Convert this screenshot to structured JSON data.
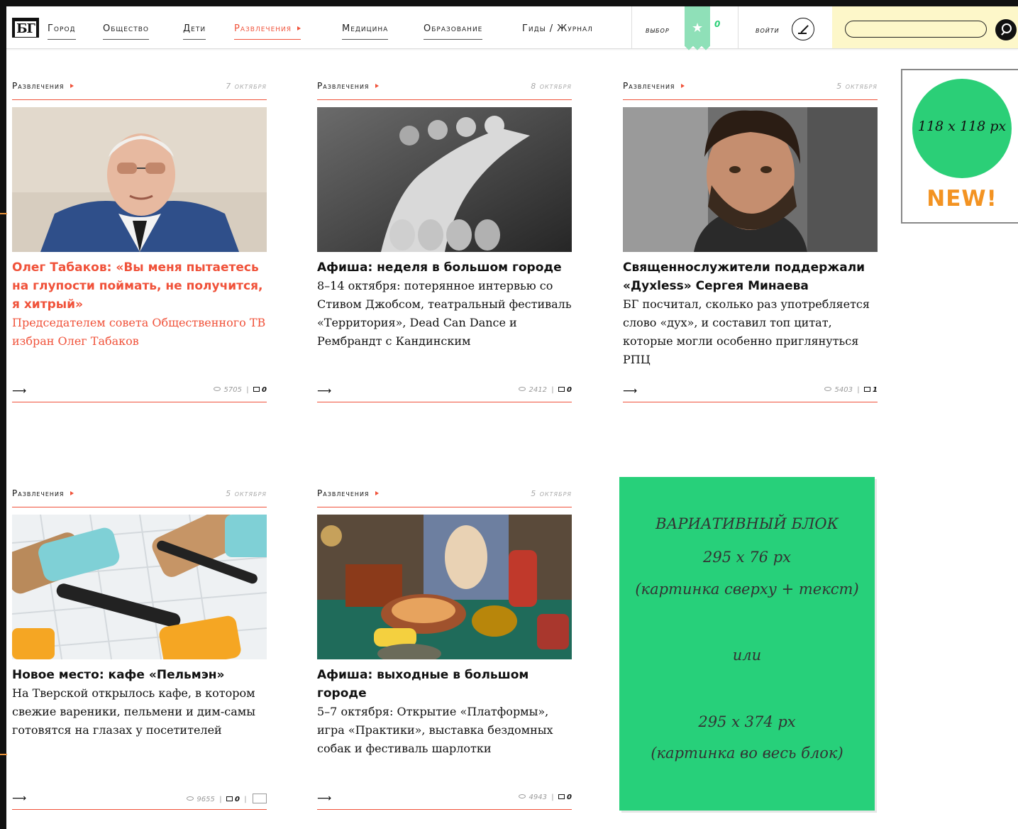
{
  "header": {
    "logo": "БГ",
    "nav": [
      {
        "label": "Город",
        "active": false
      },
      {
        "label": "Общество",
        "active": false
      },
      {
        "label": "Дети",
        "active": false
      },
      {
        "label": "Развлечения",
        "active": true
      },
      {
        "label": "Медицина",
        "active": false
      },
      {
        "label": "Образование",
        "active": false
      }
    ],
    "guides_label": "Гиды / Журнал",
    "favorites_label": "выбор",
    "favorites_count": "0",
    "login_label": "войти",
    "search_placeholder": ""
  },
  "cards": [
    {
      "category": "Развлечения",
      "date": "7 октября",
      "title": "Олег Табаков: «Вы меня пытаетесь на глупости поймать, не получится, я хитрый»",
      "text": "Председателем совета Общественного ТВ избран Олег Табаков",
      "highlighted": true,
      "views": "5705",
      "comments": "0",
      "image": "portrait-man-glasses"
    },
    {
      "category": "Развлечения",
      "date": "8 октября",
      "title": "Афиша: неделя в большом городе",
      "text": "8–14 октября: потерянное интервью со Стивом Джобсом, театральный фестиваль «Территория», Dead Can Dance и Рембрандт с Кандинским",
      "highlighted": false,
      "views": "2412",
      "comments": "0",
      "image": "bw-dancer-photo"
    },
    {
      "category": "Развлечения",
      "date": "5 октября",
      "title": "Священнослужители поддержали «Духless» Сергея Минаева",
      "text": "БГ посчитал, сколько раз употребляется слово «дух», и составил топ цитат, которые могли особенно приглянуться РПЦ",
      "highlighted": false,
      "views": "5403",
      "comments": "1",
      "image": "bearded-man-portrait"
    },
    {
      "category": "Развлечения",
      "date": "5 октября",
      "title": "Новое место: кафе «Пельмэн»",
      "text": "На Тверской открылось кафе, в котором свежие вареники, пельмени и дим-самы готовятся на глазах у посетителей",
      "highlighted": false,
      "views": "9655",
      "comments": "0",
      "has_photo_icon": true,
      "image": "cutting-boards-rolling-pins"
    },
    {
      "category": "Развлечения",
      "date": "5 октября",
      "title": "Афиша: выходные в большом городе",
      "text": "5–7 октября: Открытие «Платформы», игра «Практики», выставка бездомных собак и фестиваль шарлотки",
      "highlighted": false,
      "views": "4943",
      "comments": "0",
      "image": "flea-market-items"
    }
  ],
  "badge": {
    "size_text": "118 x 118 px",
    "new_label": "NEW!"
  },
  "variative_block": {
    "lines": [
      "ВАРИАТИВНЫЙ БЛОК",
      "295 x 76 px",
      "(картинка сверху + текст)",
      "или",
      "295 x 374 px",
      "(картинка во весь блок)"
    ]
  },
  "colors": {
    "accent": "#f0523a",
    "green": "#27d07a",
    "badge_orange": "#f39322",
    "search_bg": "#fdf7c9"
  }
}
